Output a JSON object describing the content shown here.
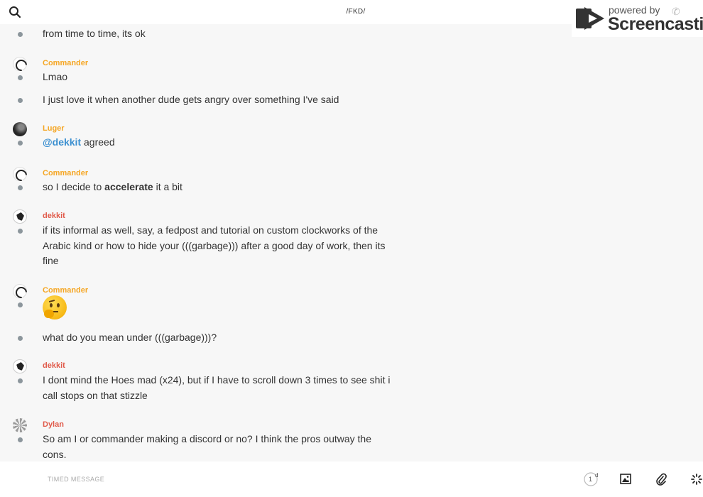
{
  "header": {
    "title": "/FKD/"
  },
  "watermark": {
    "small": "powered by",
    "brand": "Screencastify"
  },
  "messages": [
    {
      "text": "from time to time, its ok"
    },
    {
      "user": "Commander",
      "text": "Lmao"
    },
    {
      "text": "I just love it when another dude gets angry over something I've said"
    },
    {
      "user": "Luger",
      "mention": "@dekkit",
      "text": " agreed"
    },
    {
      "user": "Commander",
      "pre": "so I decide to ",
      "bold": "accelerate",
      "post": " it a bit"
    },
    {
      "user": "dekkit",
      "text": "if its informal as well, say, a fedpost and tutorial on custom clockworks of the Arabic kind or how to hide your (((garbage))) after a good day of work, then its fine"
    },
    {
      "user": "Commander",
      "emoji": "thinking-face"
    },
    {
      "text": "what do you mean under (((garbage)))?"
    },
    {
      "user": "dekkit",
      "text": "I dont mind the Hoes mad (x24), but if I have to scroll down 3 times to see shit i call stops on that stizzle"
    },
    {
      "user": "Dylan",
      "text": "So am I or commander making a discord or no? I think the pros outway the cons."
    }
  ],
  "composer": {
    "placeholder": "TIMED MESSAGE",
    "timer_value": "1",
    "timer_unit": "d",
    "icons": [
      "timer-icon",
      "image-icon",
      "paperclip-icon",
      "spinner-icon"
    ]
  },
  "colors": {
    "username_orange": "#f5a623",
    "username_red": "#e05a4a",
    "mention": "#3a8fd0"
  }
}
